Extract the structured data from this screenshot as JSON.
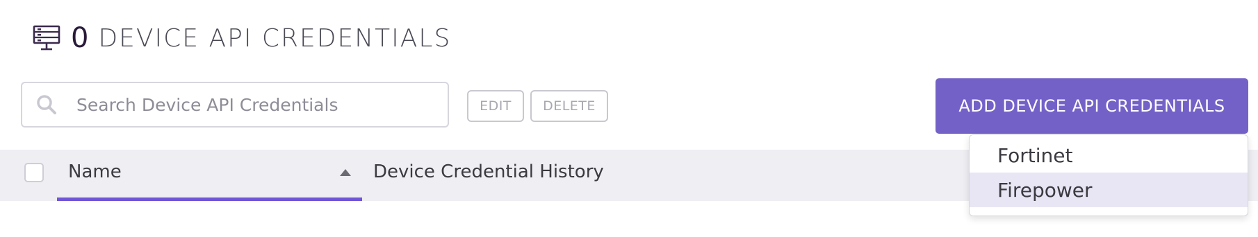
{
  "header": {
    "icon": "device-server-icon",
    "count": "0",
    "title": "DEVICE API CREDENTIALS"
  },
  "toolbar": {
    "search_placeholder": "Search Device API Credentials",
    "search_value": "",
    "edit_label": "EDIT",
    "delete_label": "DELETE",
    "add_label": "ADD DEVICE API CREDENTIALS"
  },
  "table": {
    "columns": [
      {
        "label": "Name",
        "sorted": "ascending"
      },
      {
        "label": "Device Credential History"
      }
    ]
  },
  "dropdown": {
    "items": [
      {
        "label": "Fortinet"
      },
      {
        "label": "Firepower"
      }
    ]
  },
  "colors": {
    "accent": "#7461c8",
    "underline": "#7055d6",
    "table_header_bg": "#eeeef3",
    "hover_bg": "#e8e6f4"
  }
}
